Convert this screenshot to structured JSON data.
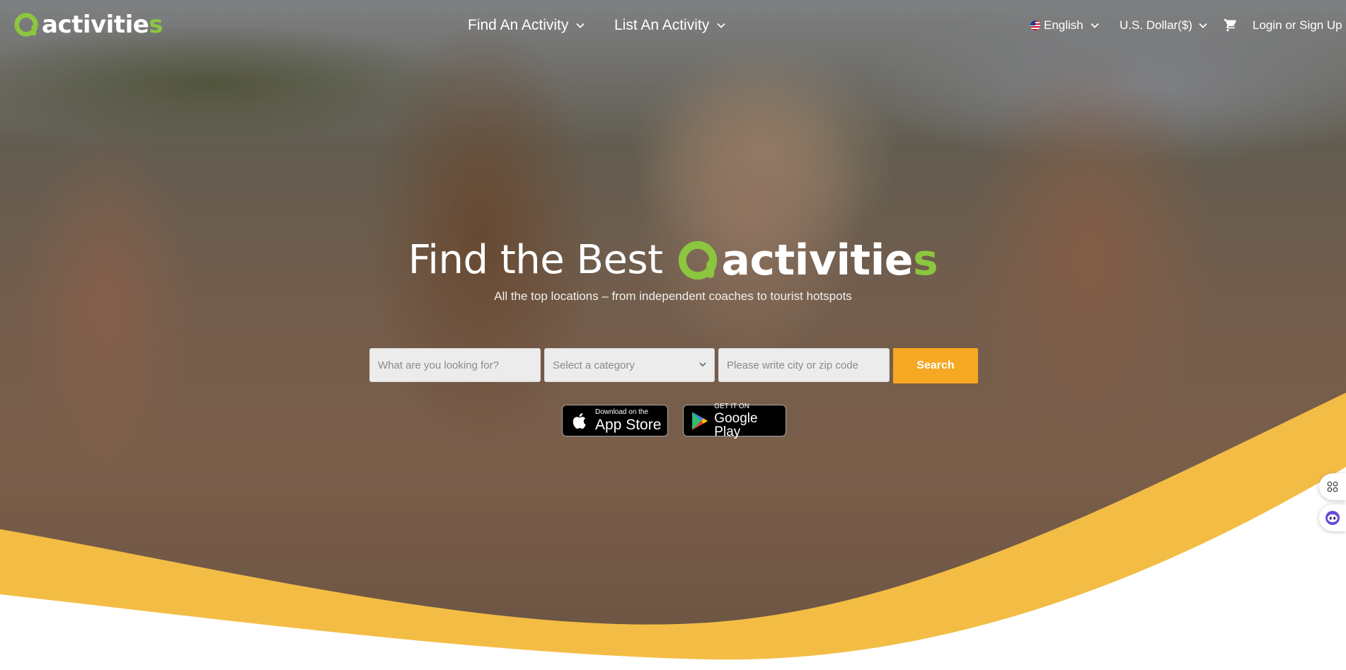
{
  "header": {
    "logo_text_main": "activitie",
    "logo_text_accent": "s",
    "nav": [
      {
        "label": "Find An Activity"
      },
      {
        "label": "List An Activity"
      }
    ],
    "language": "English",
    "currency": "U.S. Dollar($)",
    "login_label": "Login or Sign Up"
  },
  "hero": {
    "headline": "Find the Best",
    "logo_text_main": "activitie",
    "logo_text_accent": "s",
    "subtitle": "All the top locations – from independent coaches to tourist hotspots"
  },
  "search": {
    "query_placeholder": "What are you looking for?",
    "category_placeholder": "Select a category",
    "location_placeholder": "Please write city or zip code",
    "button_label": "Search"
  },
  "apps": {
    "appstore_small": "Download on the",
    "appstore_big": "App Store",
    "googleplay_small": "GET IT ON",
    "googleplay_big": "Google Play"
  },
  "colors": {
    "brand_green": "#8cc63f",
    "accent_orange": "#f6a724",
    "wave_yellow": "#f3bd45"
  },
  "icons": [
    "logo-mark-icon",
    "chevron-down-icon",
    "us-flag-icon",
    "cart-icon",
    "apple-icon",
    "google-play-icon",
    "apps-grid-icon",
    "assistant-bot-icon"
  ]
}
